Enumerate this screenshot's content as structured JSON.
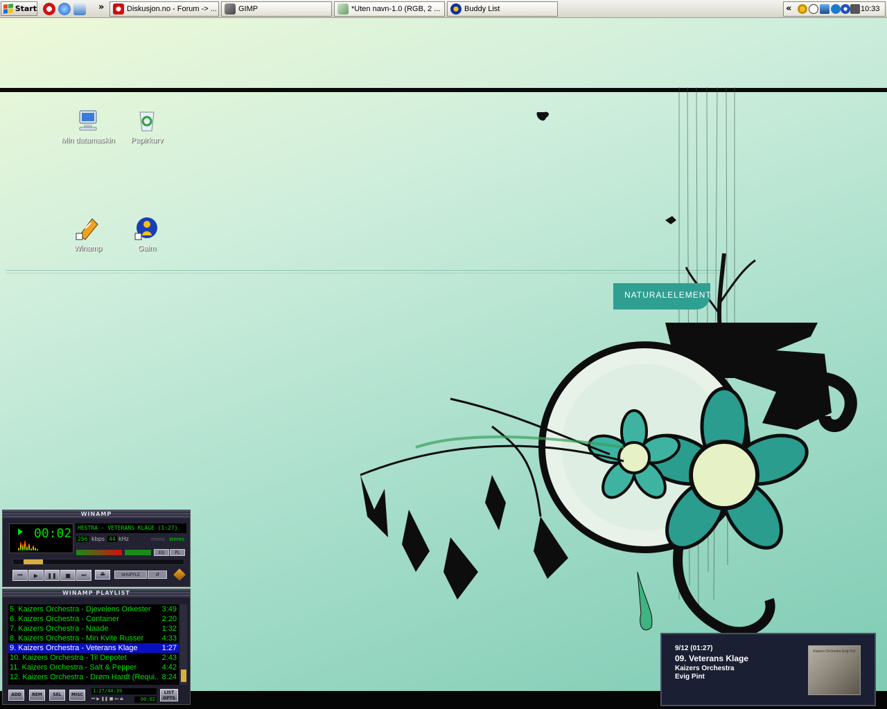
{
  "taskbar": {
    "start_label": "Start",
    "overflow_chevron": "»",
    "quicklaunch": [
      "opera-icon",
      "ie-icon",
      "desktop-icon"
    ],
    "tasks": [
      {
        "label": "Diskusjon.no - Forum -> ...",
        "icon": "opera-icon",
        "color": "#cc1010"
      },
      {
        "label": "GIMP",
        "icon": "gimp-icon",
        "color": "#777"
      },
      {
        "label": "*Uten navn-1.0 (RGB, 2 ...",
        "icon": "image-icon",
        "color": "#6a9a6a"
      },
      {
        "label": "Buddy List",
        "icon": "gaim-icon",
        "color": "#1030a0"
      }
    ],
    "tray": {
      "chevron": "«",
      "icons": [
        "gaim-tray-icon",
        "winamp-play-icon",
        "network-icon",
        "skype-icon",
        "info-icon",
        "volume-icon"
      ],
      "clock": "10:33"
    }
  },
  "desktop": {
    "icons": [
      {
        "label": "Min datamaskin",
        "icon": "computer-icon"
      },
      {
        "label": "Papirkurv",
        "icon": "recycle-bin-icon"
      },
      {
        "label": "Winamp",
        "icon": "winamp-icon"
      },
      {
        "label": "Gaim",
        "icon": "gaim-icon"
      }
    ],
    "wallpaper_brand": "NATURALELEMENT"
  },
  "winamp": {
    "title": "WINAMP",
    "time": "00:02",
    "marquee": "HESTRA - VETERANS KLAGE (1:27)",
    "kbps": "256",
    "kbps_label": "kbps",
    "khz": "44",
    "khz_label": "kHz",
    "mono_label": "mono",
    "stereo_label": "stereo",
    "eq_label": "EQ",
    "pl_label": "PL",
    "shuffle_label": "SHUFFLE",
    "seek_position": 0.05,
    "volume_level": 0.85
  },
  "playlist": {
    "title": "WINAMP PLAYLIST",
    "rows": [
      {
        "title": "5. Kaizers Orchestra - Djevelens Orkester",
        "duration": "3:49"
      },
      {
        "title": "6. Kaizers Orchestra - Container",
        "duration": "2:20"
      },
      {
        "title": "7. Kaizers Orchestra - Naade",
        "duration": "1:32"
      },
      {
        "title": "8. Kaizers Orchestra - Min Kvite Russer",
        "duration": "4:33"
      },
      {
        "title": "9. Kaizers Orchestra - Veterans Klage",
        "duration": "1:27"
      },
      {
        "title": "10. Kaizers Orchestra - Til Depotet",
        "duration": "2:43"
      },
      {
        "title": "11. Kaizers Orchestra - Salt & Pepper",
        "duration": "4:42"
      },
      {
        "title": "12. Kaizers Orchestra - Drøm Hardt (Requi...",
        "duration": "8:24"
      }
    ],
    "selected_index": 4,
    "buttons": {
      "add": "ADD",
      "rem": "REM",
      "sel": "SEL",
      "misc": "MISC",
      "list_1": "LIST",
      "list_2": "OPTS"
    },
    "total": "1:27/44:39",
    "elapsed": "00:02"
  },
  "notification": {
    "position": "9/12 (01:27)",
    "track": "09. Veterans Klage",
    "artist": "Kaizers Orchestra",
    "album": "Evig Pint",
    "cover_text": "Kaizers Orchestra Evig Pint"
  },
  "colors": {
    "lcd_green": "#00e000",
    "playlist_selection": "#0a10c0",
    "wallpaper_teal": "#2f9f91"
  }
}
